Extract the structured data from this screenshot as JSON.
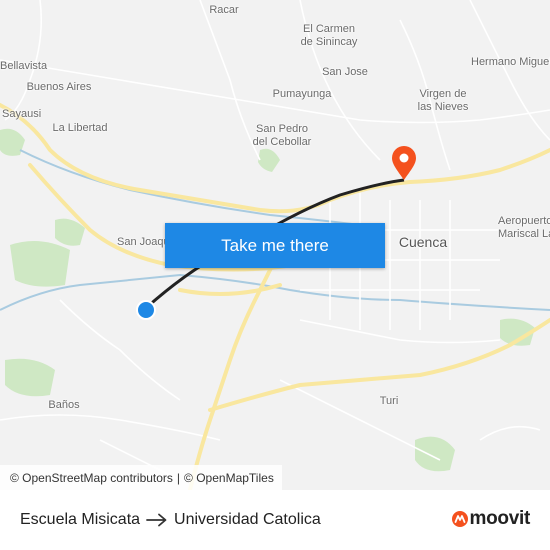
{
  "map": {
    "places": [
      {
        "name": "Racar"
      },
      {
        "name": "El Carmen\nde Sinincay"
      },
      {
        "name": "Hermano Miguel"
      },
      {
        "name": "Bellavista"
      },
      {
        "name": "Buenos Aires"
      },
      {
        "name": "San Jose"
      },
      {
        "name": "Pumayunga"
      },
      {
        "name": "Virgen de\nlas Nieves"
      },
      {
        "name": "Sayausi"
      },
      {
        "name": "La Libertad"
      },
      {
        "name": "San Pedro\ndel Cebollar"
      },
      {
        "name": "San Joaquin"
      },
      {
        "name": "Cuenca"
      },
      {
        "name": "Aeropuerto\nMariscal La"
      },
      {
        "name": "Baños"
      },
      {
        "name": "Turi"
      }
    ],
    "colors": {
      "background": "#f2f2f2",
      "major_road": "#f9e79f",
      "minor_road": "#ffffff",
      "park": "#cfe8c4",
      "water": "#a9cbe0",
      "route_line": "#222222",
      "origin_marker": "#1e88e5",
      "destination_marker": "#f4511e"
    }
  },
  "cta": {
    "label": "Take me there"
  },
  "attribution": {
    "osm": "© OpenStreetMap contributors",
    "separator": "|",
    "omt": "© OpenMapTiles"
  },
  "footer": {
    "origin": "Escuela Misicata",
    "destination": "Universidad Catolica",
    "brand": "moovit",
    "brand_color": "#f4511e"
  }
}
